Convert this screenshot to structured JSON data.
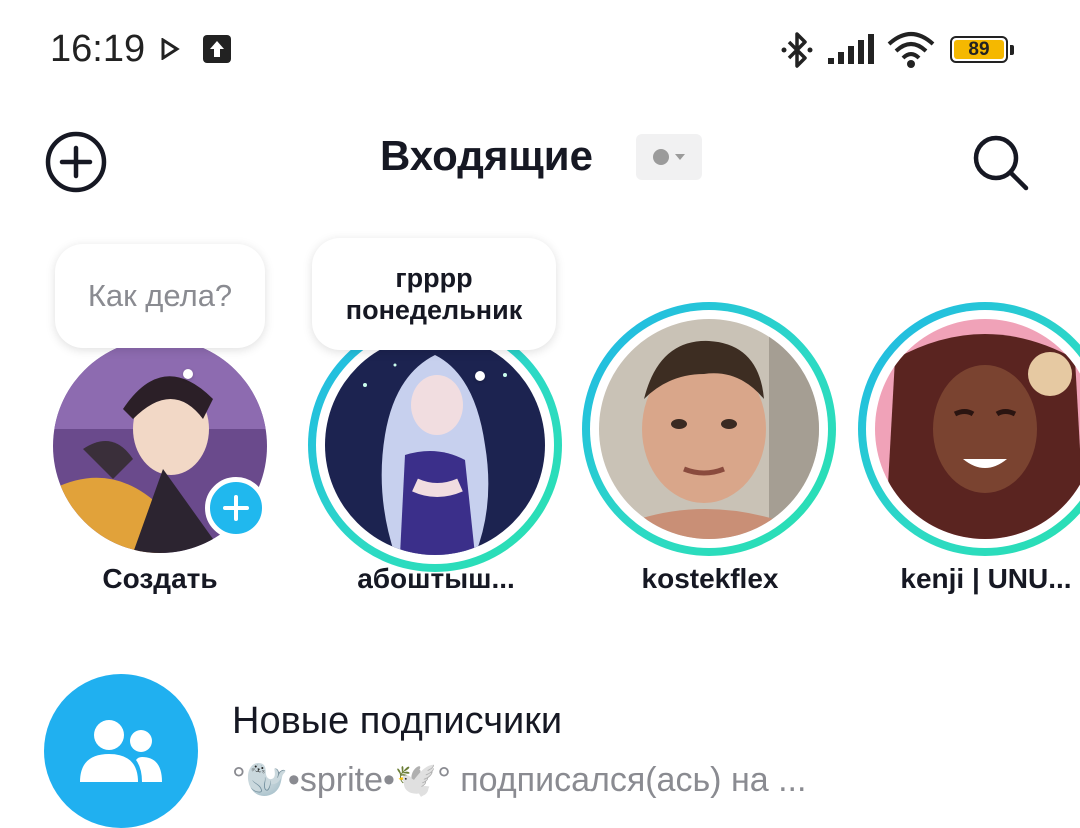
{
  "status_bar": {
    "time": "16:19",
    "battery_level": "89",
    "icons": [
      "play-notification-icon",
      "upload-notification-icon",
      "bluetooth-icon",
      "signal-icon",
      "wifi-icon",
      "battery-icon"
    ]
  },
  "header": {
    "title": "Входящие",
    "left_icon": "add-circle-icon",
    "right_icon": "search-icon"
  },
  "stories": [
    {
      "name": "Создать",
      "note": "Как дела?",
      "note_is_placeholder": true,
      "has_ring": false,
      "has_add_badge": true
    },
    {
      "name": "абоштыш...",
      "note_lines": [
        "грррр",
        "понедельник"
      ],
      "has_ring": true
    },
    {
      "name": "kostekflex",
      "has_ring": true
    },
    {
      "name": "kenji | UNU...",
      "has_ring": true
    }
  ],
  "list": [
    {
      "title": "Новые подписчики",
      "subtitle": "°🦭•sprite•🕊️° подписался(ась) на ...",
      "icon": "people-icon"
    }
  ],
  "colors": {
    "accent_blue": "#20b8ee",
    "ring_gradient_start": "#1fb5e8",
    "ring_gradient_end": "#28e0b0",
    "battery_fill": "#f5b800",
    "secondary_text": "#8a8b91"
  }
}
